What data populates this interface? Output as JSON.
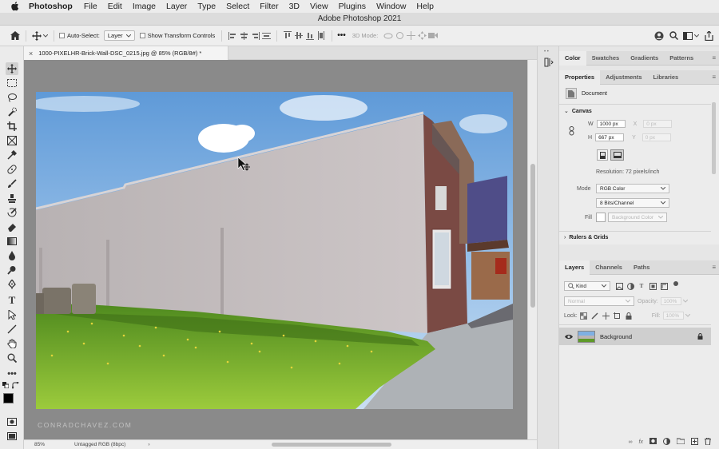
{
  "menubar": {
    "app_name": "Photoshop",
    "items": [
      "File",
      "Edit",
      "Image",
      "Layer",
      "Type",
      "Select",
      "Filter",
      "3D",
      "View",
      "Plugins",
      "Window",
      "Help"
    ]
  },
  "window": {
    "title": "Adobe Photoshop 2021"
  },
  "options_bar": {
    "auto_select_label": "Auto-Select:",
    "auto_select_target": "Layer",
    "show_transform_label": "Show Transform Controls",
    "more_label": "•••",
    "mode_3d_label": "3D Mode:"
  },
  "document": {
    "tab_title": "1000-PIXELHR-Brick-Wall-DSC_0215.jpg @ 85% (RGB/8#) *",
    "watermark": "CONRADCHAVEZ.COM"
  },
  "status_bar": {
    "zoom": "85%",
    "profile": "Untagged RGB (8bpc)"
  },
  "color_panel": {
    "tabs": [
      "Color",
      "Swatches",
      "Gradients",
      "Patterns"
    ],
    "active": "Color"
  },
  "properties_panel": {
    "tabs": [
      "Properties",
      "Adjustments",
      "Libraries"
    ],
    "active": "Properties",
    "kind_label": "Document",
    "canvas_label": "Canvas",
    "w_label": "W",
    "w_value": "1000 px",
    "h_label": "H",
    "h_value": "667 px",
    "x_label": "X",
    "y_label": "Y",
    "x_placeholder": "0 px",
    "y_placeholder": "0 px",
    "resolution": "Resolution: 72 pixels/inch",
    "mode_label": "Mode",
    "mode_value": "RGB Color",
    "depth_value": "8 Bits/Channel",
    "fill_label": "Fill",
    "fill_value": "Background Color",
    "rulers_label": "Rulers & Grids"
  },
  "layers_panel": {
    "tabs": [
      "Layers",
      "Channels",
      "Paths"
    ],
    "active": "Layers",
    "kind_filter": "Kind",
    "blend_mode": "Normal",
    "opacity_label": "Opacity:",
    "opacity_value": "100%",
    "lock_label": "Lock:",
    "fill_label": "Fill:",
    "fill_value": "100%",
    "layers": [
      {
        "name": "Background",
        "visible": true,
        "locked": true
      }
    ]
  },
  "colors": {
    "accent_blue": "#1473e6",
    "pasteboard": "#8a8a8a",
    "panel_bg": "#ececec"
  }
}
